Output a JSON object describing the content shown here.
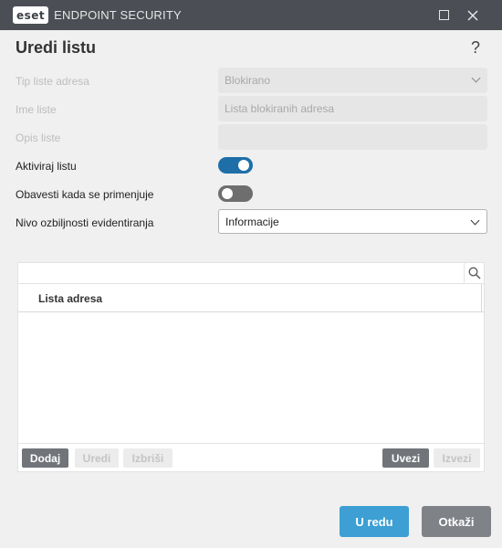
{
  "app": {
    "logo_text": "eset",
    "product_name": "ENDPOINT SECURITY"
  },
  "dialog": {
    "title": "Uredi listu",
    "help": "?"
  },
  "form": {
    "list_type_label": "Tip liste adresa",
    "list_type_value": "Blokirano",
    "list_name_label": "Ime liste",
    "list_name_value": "Lista blokiranih adresa",
    "list_desc_label": "Opis liste",
    "list_desc_value": "",
    "activate_label": "Aktiviraj listu",
    "activate_on": true,
    "notify_label": "Obavesti kada se primenjuje",
    "notify_on": false,
    "severity_label": "Nivo ozbiljnosti evidentiranja",
    "severity_value": "Informacije"
  },
  "table": {
    "search_value": "",
    "column_header": "Lista adresa",
    "rows": []
  },
  "table_buttons": {
    "add": "Dodaj",
    "edit": "Uredi",
    "delete": "Izbriši",
    "import": "Uvezi",
    "export": "Izvezi"
  },
  "footer": {
    "ok": "U redu",
    "cancel": "Otkaži"
  },
  "colors": {
    "titlebar": "#4b4e54",
    "accent": "#3d9fd3",
    "toggle_on": "#1e6fa8"
  }
}
